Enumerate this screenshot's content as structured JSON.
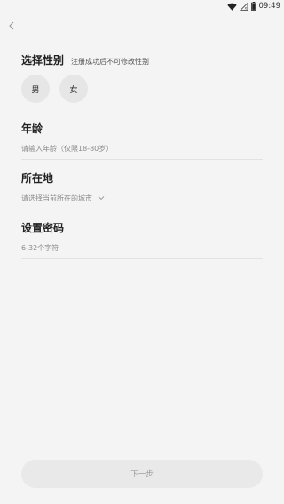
{
  "status_bar": {
    "time": "09:49",
    "battery_level": 0.8
  },
  "gender": {
    "title": "选择性别",
    "note": "注册成功后不可修改性别",
    "options": [
      "男",
      "女"
    ]
  },
  "age": {
    "label": "年龄",
    "placeholder": "请输入年龄（仅限18-80岁）"
  },
  "location": {
    "label": "所在地",
    "placeholder": "请选择当前所在的城市"
  },
  "password": {
    "label": "设置密码",
    "placeholder": "6-32个字符"
  },
  "next_button": {
    "label": "下一步"
  },
  "colors": {
    "background": "#f4f4f4",
    "chip": "#e6e6e6",
    "button": "#e9e9e9"
  }
}
